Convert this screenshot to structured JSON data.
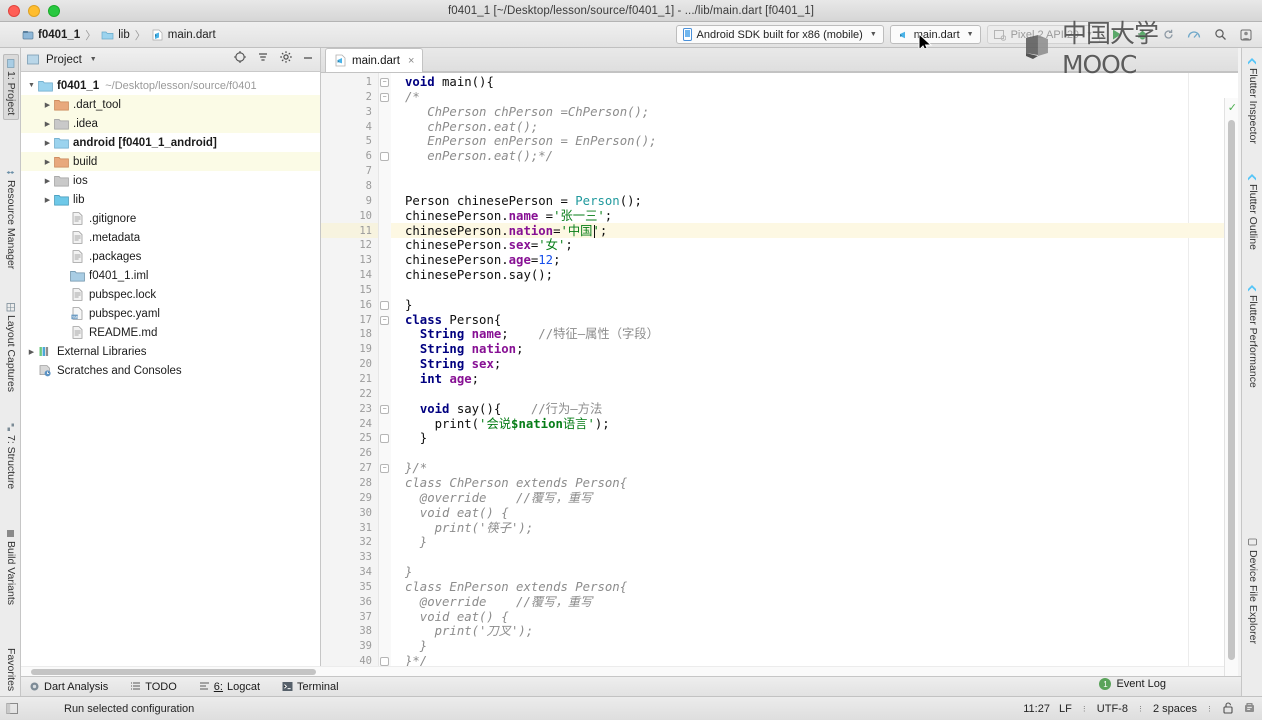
{
  "window": {
    "title": "f0401_1 [~/Desktop/lesson/source/f0401_1] - .../lib/main.dart [f0401_1]"
  },
  "breadcrumbs": [
    {
      "label": "f0401_1",
      "icon": "module-icon"
    },
    {
      "label": "lib",
      "icon": "folder-icon"
    },
    {
      "label": "main.dart",
      "icon": "dart-file-icon"
    }
  ],
  "toolbar": {
    "device_selector": "Android SDK built for x86 (mobile)",
    "run_config": "main.dart",
    "emulator_selector": "Pixel 2 API 29",
    "icons": [
      "run-icon",
      "debug-icon",
      "hot-reload-icon",
      "performance-icon",
      "search-icon",
      "settings-icon"
    ]
  },
  "left_tool_strip": [
    {
      "label": "1: Project",
      "selected": true
    },
    {
      "label": "Resource Manager",
      "selected": false
    },
    {
      "label": "Layout Captures",
      "selected": false
    },
    {
      "label": "7: Structure",
      "selected": false
    },
    {
      "label": "Build Variants",
      "selected": false
    },
    {
      "label": "Favorites",
      "selected": false
    }
  ],
  "right_tool_strip": [
    {
      "label": "Flutter Inspector"
    },
    {
      "label": "Flutter Outline"
    },
    {
      "label": "Flutter Performance"
    },
    {
      "label": "Device File Explorer"
    }
  ],
  "project_panel": {
    "title": "Project",
    "tree": [
      {
        "label": "f0401_1",
        "path": "~/Desktop/lesson/source/f0401",
        "indent": 0,
        "arrow": "open",
        "icon": "module-folder",
        "bold": true,
        "hl": false
      },
      {
        "label": ".dart_tool",
        "path": "",
        "indent": 1,
        "arrow": "closed",
        "icon": "folder-orange",
        "bold": false,
        "hl": true
      },
      {
        "label": ".idea",
        "path": "",
        "indent": 1,
        "arrow": "closed",
        "icon": "folder-gray",
        "bold": false,
        "hl": true
      },
      {
        "label": "android [f0401_1_android]",
        "path": "",
        "indent": 1,
        "arrow": "closed",
        "icon": "folder-module",
        "bold": true,
        "hl": false
      },
      {
        "label": "build",
        "path": "",
        "indent": 1,
        "arrow": "closed",
        "icon": "folder-orange",
        "bold": false,
        "hl": true
      },
      {
        "label": "ios",
        "path": "",
        "indent": 1,
        "arrow": "closed",
        "icon": "folder-gray",
        "bold": false,
        "hl": false
      },
      {
        "label": "lib",
        "path": "",
        "indent": 1,
        "arrow": "closed",
        "icon": "folder-blue",
        "bold": false,
        "hl": false
      },
      {
        "label": ".gitignore",
        "path": "",
        "indent": 2,
        "arrow": "none",
        "icon": "file-text",
        "bold": false,
        "hl": false
      },
      {
        "label": ".metadata",
        "path": "",
        "indent": 2,
        "arrow": "none",
        "icon": "file-text",
        "bold": false,
        "hl": false
      },
      {
        "label": ".packages",
        "path": "",
        "indent": 2,
        "arrow": "none",
        "icon": "file-text",
        "bold": false,
        "hl": false
      },
      {
        "label": "f0401_1.iml",
        "path": "",
        "indent": 2,
        "arrow": "none",
        "icon": "file-iml",
        "bold": false,
        "hl": false
      },
      {
        "label": "pubspec.lock",
        "path": "",
        "indent": 2,
        "arrow": "none",
        "icon": "file-text",
        "bold": false,
        "hl": false
      },
      {
        "label": "pubspec.yaml",
        "path": "",
        "indent": 2,
        "arrow": "none",
        "icon": "file-yaml",
        "bold": false,
        "hl": false
      },
      {
        "label": "README.md",
        "path": "",
        "indent": 2,
        "arrow": "none",
        "icon": "file-text",
        "bold": false,
        "hl": false
      },
      {
        "label": "External Libraries",
        "path": "",
        "indent": 0,
        "arrow": "closed",
        "icon": "libraries",
        "bold": false,
        "hl": false
      },
      {
        "label": "Scratches and Consoles",
        "path": "",
        "indent": 0,
        "arrow": "none",
        "icon": "scratches",
        "bold": false,
        "hl": false
      }
    ]
  },
  "editor": {
    "tab": {
      "label": "main.dart",
      "close": "×"
    },
    "highlight_line": 11,
    "caret_line": 11,
    "line_count": 40,
    "lines": [
      {
        "n": 1,
        "text": "void main(){"
      },
      {
        "n": 2,
        "text": "/*"
      },
      {
        "n": 3,
        "text": "   ChPerson chPerson =ChPerson();"
      },
      {
        "n": 4,
        "text": "   chPerson.eat();"
      },
      {
        "n": 5,
        "text": "   EnPerson enPerson = EnPerson();"
      },
      {
        "n": 6,
        "text": "   enPerson.eat();*/"
      },
      {
        "n": 7,
        "text": ""
      },
      {
        "n": 8,
        "text": ""
      },
      {
        "n": 9,
        "text": "Person chinesePerson = Person();"
      },
      {
        "n": 10,
        "text": "chinesePerson.name ='张一三';"
      },
      {
        "n": 11,
        "text": "chinesePerson.nation='中国';"
      },
      {
        "n": 12,
        "text": "chinesePerson.sex='女';"
      },
      {
        "n": 13,
        "text": "chinesePerson.age=12;"
      },
      {
        "n": 14,
        "text": "chinesePerson.say();"
      },
      {
        "n": 15,
        "text": ""
      },
      {
        "n": 16,
        "text": "}"
      },
      {
        "n": 17,
        "text": "class Person{"
      },
      {
        "n": 18,
        "text": "  String name;    //特征—属性（字段）"
      },
      {
        "n": 19,
        "text": "  String nation;"
      },
      {
        "n": 20,
        "text": "  String sex;"
      },
      {
        "n": 21,
        "text": "  int age;"
      },
      {
        "n": 22,
        "text": ""
      },
      {
        "n": 23,
        "text": "  void say(){    //行为—方法"
      },
      {
        "n": 24,
        "text": "    print('会说$nation语言');"
      },
      {
        "n": 25,
        "text": "  }"
      },
      {
        "n": 26,
        "text": ""
      },
      {
        "n": 27,
        "text": "}/*"
      },
      {
        "n": 28,
        "text": "class ChPerson extends Person{"
      },
      {
        "n": 29,
        "text": "  @override    //覆写，重写"
      },
      {
        "n": 30,
        "text": "  void eat() {"
      },
      {
        "n": 31,
        "text": "    print('筷子');"
      },
      {
        "n": 32,
        "text": "  }"
      },
      {
        "n": 33,
        "text": ""
      },
      {
        "n": 34,
        "text": "}"
      },
      {
        "n": 35,
        "text": "class EnPerson extends Person{"
      },
      {
        "n": 36,
        "text": "  @override    //覆写，重写"
      },
      {
        "n": 37,
        "text": "  void eat() {"
      },
      {
        "n": 38,
        "text": "    print('刀叉');"
      },
      {
        "n": 39,
        "text": "  }"
      },
      {
        "n": 40,
        "text": "}*/"
      }
    ]
  },
  "bottom_bar": [
    {
      "label": "Dart Analysis",
      "icon": "dart-icon",
      "prefix": ""
    },
    {
      "label": "TODO",
      "icon": "todo-icon",
      "prefix": ""
    },
    {
      "label": "Logcat",
      "icon": "logcat-icon",
      "prefix": "6:"
    },
    {
      "label": "Terminal",
      "icon": "terminal-icon",
      "prefix": ""
    }
  ],
  "event_log": {
    "label": "Event Log",
    "count": "1"
  },
  "status_bar": {
    "message": "Run selected configuration",
    "position": "11:27",
    "line_separator": "LF",
    "encoding": "UTF-8",
    "indent": "2 spaces",
    "icons": [
      "lock-icon",
      "inspector-icon"
    ]
  },
  "watermark": {
    "text": "中国大学MOOC"
  },
  "colors": {
    "keyword": "#000080",
    "field": "#871094",
    "string": "#067d17",
    "number": "#1750eb",
    "class": "#20999d",
    "comment": "#8c8c8c",
    "highlight_row": "#fdf8e3",
    "tree_highlight": "#fbfbe6"
  }
}
